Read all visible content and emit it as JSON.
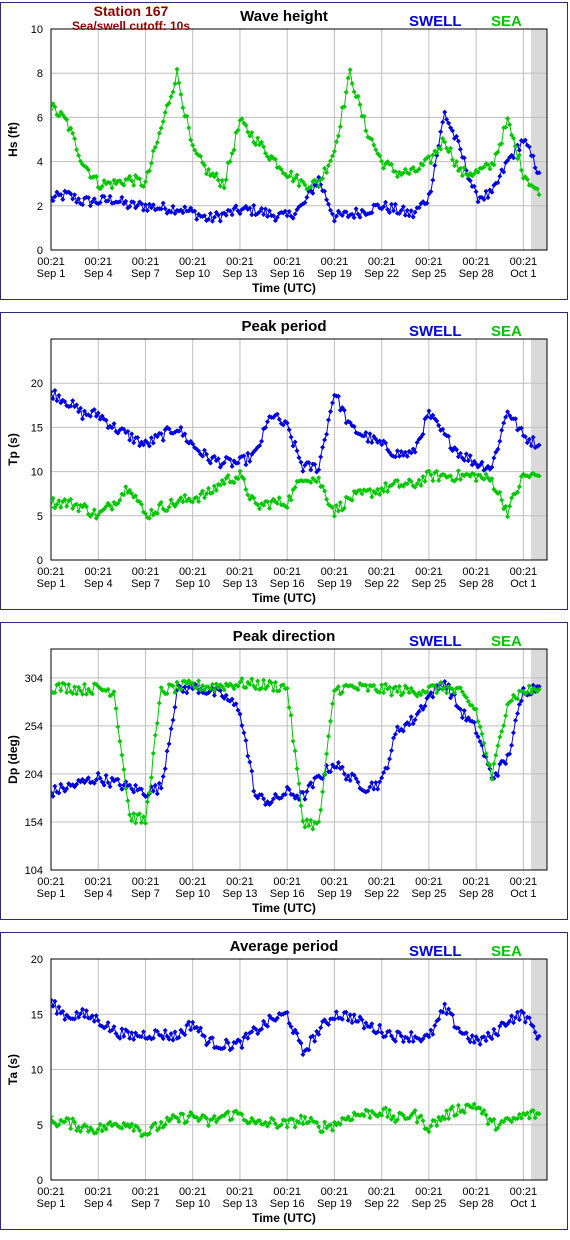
{
  "station": {
    "name": "Station 167",
    "cutoff": "Sea/swell cutoff: 10s"
  },
  "legend": {
    "swell": "SWELL",
    "sea": "SEA"
  },
  "colors": {
    "swell": "#0000e0",
    "sea": "#00c800",
    "header": "#8b0000",
    "plot_bg": "#ffffff",
    "outside_bg": "#d9d9d9",
    "grid": "#bfbfbf"
  },
  "x_axis": {
    "title": "Time (UTC)",
    "ticks": [
      {
        "time": "00:21",
        "date": "Sep 1"
      },
      {
        "time": "00:21",
        "date": "Sep 4"
      },
      {
        "time": "00:21",
        "date": "Sep 7"
      },
      {
        "time": "00:21",
        "date": "Sep 10"
      },
      {
        "time": "00:21",
        "date": "Sep 13"
      },
      {
        "time": "00:21",
        "date": "Sep 16"
      },
      {
        "time": "00:21",
        "date": "Sep 19"
      },
      {
        "time": "00:21",
        "date": "Sep 22"
      },
      {
        "time": "00:21",
        "date": "Sep 25"
      },
      {
        "time": "00:21",
        "date": "Sep 28"
      },
      {
        "time": "00:21",
        "date": "Oct 1"
      }
    ]
  },
  "chart_data": [
    {
      "type": "line",
      "title": "Wave height",
      "ylabel": "Hs (ft)",
      "ylim": [
        0,
        10
      ],
      "yticks": [
        "0",
        "2",
        "4",
        "6",
        "8",
        "10"
      ],
      "xlim": [
        "Sep 1 00:21",
        "Oct 2 12:00"
      ],
      "grid": true,
      "legend_position": "top-right",
      "series": [
        {
          "name": "SWELL",
          "x": [
            "Sep 1",
            "Sep 2",
            "Sep 3",
            "Sep 4",
            "Sep 5",
            "Sep 6",
            "Sep 7",
            "Sep 8",
            "Sep 9",
            "Sep 10",
            "Sep 11",
            "Sep 12",
            "Sep 13",
            "Sep 14",
            "Sep 15",
            "Sep 16",
            "Sep 17",
            "Sep 18",
            "Sep 19",
            "Sep 20",
            "Sep 21",
            "Sep 22",
            "Sep 23",
            "Sep 24",
            "Sep 25",
            "Sep 26",
            "Sep 27",
            "Sep 28",
            "Sep 29",
            "Sep 30",
            "Oct 1",
            "Oct 2"
          ],
          "values": [
            2.3,
            2.5,
            2.2,
            2.2,
            2.3,
            2.0,
            2.0,
            1.9,
            1.9,
            1.7,
            1.4,
            1.6,
            1.8,
            1.8,
            1.6,
            1.5,
            2.0,
            3.2,
            1.5,
            1.6,
            1.8,
            2.0,
            1.8,
            1.6,
            2.4,
            6.2,
            4.5,
            2.4,
            2.5,
            4.0,
            5.0,
            3.5
          ]
        },
        {
          "name": "SEA",
          "x": [
            "Sep 1",
            "Sep 2",
            "Sep 3",
            "Sep 4",
            "Sep 5",
            "Sep 6",
            "Sep 7",
            "Sep 8",
            "Sep 9",
            "Sep 10",
            "Sep 11",
            "Sep 12",
            "Sep 13",
            "Sep 14",
            "Sep 15",
            "Sep 16",
            "Sep 17",
            "Sep 18",
            "Sep 19",
            "Sep 20",
            "Sep 21",
            "Sep 22",
            "Sep 23",
            "Sep 24",
            "Sep 25",
            "Sep 26",
            "Sep 27",
            "Sep 28",
            "Sep 29",
            "Sep 30",
            "Oct 1",
            "Oct 2"
          ],
          "values": [
            6.5,
            5.8,
            4.0,
            3.0,
            3.0,
            3.2,
            3.0,
            5.5,
            8.0,
            4.5,
            3.5,
            3.0,
            5.8,
            5.0,
            4.2,
            3.5,
            3.0,
            3.0,
            4.5,
            8.0,
            5.5,
            4.0,
            3.5,
            3.5,
            4.0,
            5.0,
            3.5,
            3.5,
            3.8,
            5.8,
            3.5,
            2.5
          ]
        }
      ]
    },
    {
      "type": "line",
      "title": "Peak period",
      "ylabel": "Tp (s)",
      "ylim": [
        0,
        25
      ],
      "yticks": [
        "0",
        "5",
        "10",
        "15",
        "20"
      ],
      "xlim": [
        "Sep 1 00:21",
        "Oct 2 12:00"
      ],
      "grid": true,
      "legend_position": "top-right",
      "series": [
        {
          "name": "SWELL",
          "x": [
            "Sep 1",
            "Sep 2",
            "Sep 3",
            "Sep 4",
            "Sep 5",
            "Sep 6",
            "Sep 7",
            "Sep 8",
            "Sep 9",
            "Sep 10",
            "Sep 11",
            "Sep 12",
            "Sep 13",
            "Sep 14",
            "Sep 15",
            "Sep 16",
            "Sep 17",
            "Sep 18",
            "Sep 19",
            "Sep 20",
            "Sep 21",
            "Sep 22",
            "Sep 23",
            "Sep 24",
            "Sep 25",
            "Sep 26",
            "Sep 27",
            "Sep 28",
            "Sep 29",
            "Sep 30",
            "Oct 1",
            "Oct 2"
          ],
          "values": [
            19,
            18,
            16.5,
            16.5,
            15,
            14,
            13,
            14,
            15,
            13,
            11.5,
            11,
            11,
            12,
            16.5,
            15,
            10.5,
            10.5,
            19,
            15,
            14,
            13,
            12,
            12,
            16.5,
            14,
            12,
            11,
            10.5,
            17,
            14,
            13
          ]
        },
        {
          "name": "SEA",
          "x": [
            "Sep 1",
            "Sep 2",
            "Sep 3",
            "Sep 4",
            "Sep 5",
            "Sep 6",
            "Sep 7",
            "Sep 8",
            "Sep 9",
            "Sep 10",
            "Sep 11",
            "Sep 12",
            "Sep 13",
            "Sep 14",
            "Sep 15",
            "Sep 16",
            "Sep 17",
            "Sep 18",
            "Sep 19",
            "Sep 20",
            "Sep 21",
            "Sep 22",
            "Sep 23",
            "Sep 24",
            "Sep 25",
            "Sep 26",
            "Sep 27",
            "Sep 28",
            "Sep 29",
            "Sep 30",
            "Oct 1",
            "Oct 2"
          ],
          "values": [
            6.5,
            6.5,
            6.0,
            5.0,
            6.5,
            8.5,
            5.0,
            6.0,
            6.5,
            7.0,
            7.5,
            9.0,
            9.5,
            6.0,
            6.5,
            6.5,
            9.5,
            9.0,
            5.5,
            7.0,
            7.5,
            8.0,
            8.5,
            8.5,
            9.5,
            9.5,
            9.5,
            9.5,
            9.0,
            5.5,
            9.5,
            9.5
          ]
        }
      ]
    },
    {
      "type": "scatter",
      "title": "Peak direction",
      "ylabel": "Dp (deg)",
      "ylim": [
        104,
        334
      ],
      "yticks": [
        "104",
        "154",
        "204",
        "254",
        "304"
      ],
      "xlim": [
        "Sep 1 00:21",
        "Oct 2 12:00"
      ],
      "grid": true,
      "legend_position": "top-right",
      "series": [
        {
          "name": "SWELL",
          "x": [
            "Sep 1",
            "Sep 2",
            "Sep 3",
            "Sep 4",
            "Sep 5",
            "Sep 6",
            "Sep 7",
            "Sep 8",
            "Sep 9",
            "Sep 10",
            "Sep 11",
            "Sep 12",
            "Sep 13",
            "Sep 14",
            "Sep 15",
            "Sep 16",
            "Sep 17",
            "Sep 18",
            "Sep 19",
            "Sep 20",
            "Sep 21",
            "Sep 22",
            "Sep 23",
            "Sep 24",
            "Sep 25",
            "Sep 26",
            "Sep 27",
            "Sep 28",
            "Sep 29",
            "Sep 30",
            "Oct 1",
            "Oct 2"
          ],
          "values": [
            185,
            190,
            195,
            200,
            195,
            190,
            185,
            190,
            290,
            295,
            290,
            285,
            270,
            180,
            175,
            185,
            180,
            200,
            215,
            200,
            190,
            195,
            250,
            260,
            285,
            300,
            270,
            250,
            200,
            220,
            290,
            295
          ]
        },
        {
          "name": "SEA",
          "x": [
            "Sep 1",
            "Sep 2",
            "Sep 3",
            "Sep 4",
            "Sep 5",
            "Sep 6",
            "Sep 7",
            "Sep 8",
            "Sep 9",
            "Sep 10",
            "Sep 11",
            "Sep 12",
            "Sep 13",
            "Sep 14",
            "Sep 15",
            "Sep 16",
            "Sep 17",
            "Sep 18",
            "Sep 19",
            "Sep 20",
            "Sep 21",
            "Sep 22",
            "Sep 23",
            "Sep 24",
            "Sep 25",
            "Sep 26",
            "Sep 27",
            "Sep 28",
            "Sep 29",
            "Sep 30",
            "Oct 1",
            "Oct 2"
          ],
          "values": [
            294,
            294,
            292,
            293,
            290,
            160,
            155,
            290,
            294,
            296,
            295,
            296,
            298,
            297,
            296,
            294,
            155,
            150,
            292,
            294,
            293,
            292,
            291,
            290,
            292,
            294,
            288,
            270,
            200,
            280,
            290,
            292
          ]
        }
      ]
    },
    {
      "type": "line",
      "title": "Average period",
      "ylabel": "Ta (s)",
      "ylim": [
        0,
        20
      ],
      "yticks": [
        "0",
        "5",
        "10",
        "15",
        "20"
      ],
      "xlim": [
        "Sep 1 00:21",
        "Oct 2 12:00"
      ],
      "grid": true,
      "legend_position": "top-right",
      "series": [
        {
          "name": "SWELL",
          "x": [
            "Sep 1",
            "Sep 2",
            "Sep 3",
            "Sep 4",
            "Sep 5",
            "Sep 6",
            "Sep 7",
            "Sep 8",
            "Sep 9",
            "Sep 10",
            "Sep 11",
            "Sep 12",
            "Sep 13",
            "Sep 14",
            "Sep 15",
            "Sep 16",
            "Sep 17",
            "Sep 18",
            "Sep 19",
            "Sep 20",
            "Sep 21",
            "Sep 22",
            "Sep 23",
            "Sep 24",
            "Sep 25",
            "Sep 26",
            "Sep 27",
            "Sep 28",
            "Sep 29",
            "Sep 30",
            "Oct 1",
            "Oct 2"
          ],
          "values": [
            16,
            14.8,
            15,
            14.5,
            13.5,
            13,
            13.2,
            13.2,
            13,
            14.2,
            12.5,
            12.2,
            12.3,
            13.5,
            14.5,
            15,
            11.5,
            13.5,
            15,
            14.8,
            14,
            13.5,
            13,
            13,
            12.8,
            15.5,
            13.5,
            12.5,
            13,
            14.5,
            15,
            13
          ]
        },
        {
          "name": "SEA",
          "x": [
            "Sep 1",
            "Sep 2",
            "Sep 3",
            "Sep 4",
            "Sep 5",
            "Sep 6",
            "Sep 7",
            "Sep 8",
            "Sep 9",
            "Sep 10",
            "Sep 11",
            "Sep 12",
            "Sep 13",
            "Sep 14",
            "Sep 15",
            "Sep 16",
            "Sep 17",
            "Sep 18",
            "Sep 19",
            "Sep 20",
            "Sep 21",
            "Sep 22",
            "Sep 23",
            "Sep 24",
            "Sep 25",
            "Sep 26",
            "Sep 27",
            "Sep 28",
            "Sep 29",
            "Sep 30",
            "Oct 1",
            "Oct 2"
          ],
          "values": [
            5.3,
            5.2,
            4.8,
            4.6,
            5.0,
            5.2,
            4.2,
            5.0,
            5.5,
            5.8,
            5.2,
            5.8,
            6.0,
            5.0,
            5.2,
            5.0,
            5.5,
            4.8,
            5.0,
            5.8,
            6.0,
            6.2,
            5.5,
            6.0,
            4.8,
            5.8,
            6.5,
            6.8,
            5.0,
            5.2,
            5.8,
            6.0
          ]
        }
      ]
    }
  ]
}
